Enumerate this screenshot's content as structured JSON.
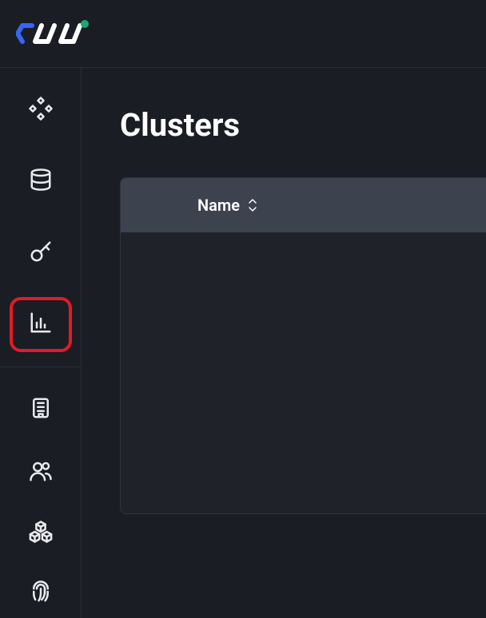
{
  "page": {
    "title": "Clusters"
  },
  "table": {
    "columns": [
      {
        "label": "Name"
      }
    ]
  },
  "sidebar": {
    "items": [
      {
        "name": "services",
        "highlighted": false
      },
      {
        "name": "database",
        "highlighted": false
      },
      {
        "name": "api-keys",
        "highlighted": false
      },
      {
        "name": "analytics",
        "highlighted": true
      },
      {
        "name": "billing",
        "highlighted": false
      },
      {
        "name": "team",
        "highlighted": false
      },
      {
        "name": "integrations",
        "highlighted": false
      },
      {
        "name": "security",
        "highlighted": false
      }
    ]
  }
}
